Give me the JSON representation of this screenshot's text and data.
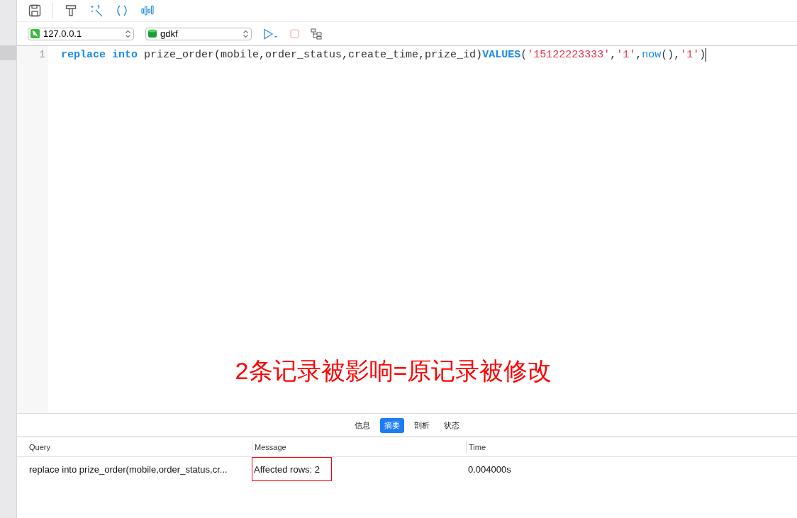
{
  "toolbar": {
    "buttons": [
      {
        "kind": "save"
      },
      {
        "kind": "format"
      },
      {
        "kind": "beautify"
      },
      {
        "kind": "parens"
      },
      {
        "kind": "explain"
      }
    ]
  },
  "connection": {
    "server": "127.0.0.1",
    "database": "gdkf"
  },
  "editor": {
    "lines": [
      {
        "number": "1",
        "tokens": [
          {
            "kind": "keyword",
            "text": "replace into"
          },
          {
            "kind": "plain",
            "text": " prize_order(mobile,order_status,create_time,prize_id)"
          },
          {
            "kind": "keyword",
            "text": "VALUES"
          },
          {
            "kind": "plain",
            "text": "("
          },
          {
            "kind": "string",
            "text": "'15122223333'"
          },
          {
            "kind": "plain",
            "text": ","
          },
          {
            "kind": "string",
            "text": "'1'"
          },
          {
            "kind": "plain",
            "text": ","
          },
          {
            "kind": "function",
            "text": "now"
          },
          {
            "kind": "plain",
            "text": "(),"
          },
          {
            "kind": "string",
            "text": "'1'"
          },
          {
            "kind": "plain",
            "text": ")"
          }
        ]
      }
    ],
    "annotation": "2条记录被影响=原记录被修改"
  },
  "result_tabs": [
    {
      "label": "信息",
      "selected": false
    },
    {
      "label": "摘要",
      "selected": true
    },
    {
      "label": "剖析",
      "selected": false
    },
    {
      "label": "状态",
      "selected": false
    }
  ],
  "table": {
    "columns": [
      "Query",
      "Message",
      "Time"
    ],
    "rows": [
      {
        "cells": [
          {
            "text": "replace into prize_order(mobile,order_status,cr...",
            "highlighted": false
          },
          {
            "text": "Affected rows: 2",
            "highlighted": true
          },
          {
            "text": "0.004000s",
            "highlighted": false
          }
        ]
      }
    ]
  }
}
